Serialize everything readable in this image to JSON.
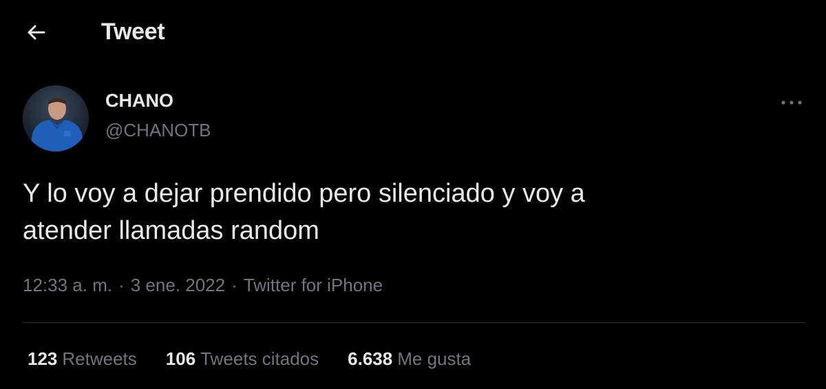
{
  "header": {
    "back_icon": "arrow-left-icon",
    "title": "Tweet"
  },
  "author": {
    "name": "CHANO",
    "handle": "@CHANOTB",
    "avatar_icon": "user-avatar"
  },
  "more_icon": "more-horizontal-icon",
  "tweet": {
    "text": "Y lo voy a dejar prendido pero silenciado y voy a\natender llamadas random"
  },
  "meta": {
    "time": "12:33 a. m.",
    "separator": "·",
    "date": "3 ene. 2022",
    "source": "Twitter for iPhone"
  },
  "stats": [
    {
      "count": "123",
      "label": "Retweets"
    },
    {
      "count": "106",
      "label": "Tweets citados"
    },
    {
      "count": "6.638",
      "label": "Me gusta"
    }
  ],
  "colors": {
    "background": "#000000",
    "primary_text": "#e7e9ea",
    "secondary_text": "#71767b",
    "divider": "#2f3336"
  }
}
